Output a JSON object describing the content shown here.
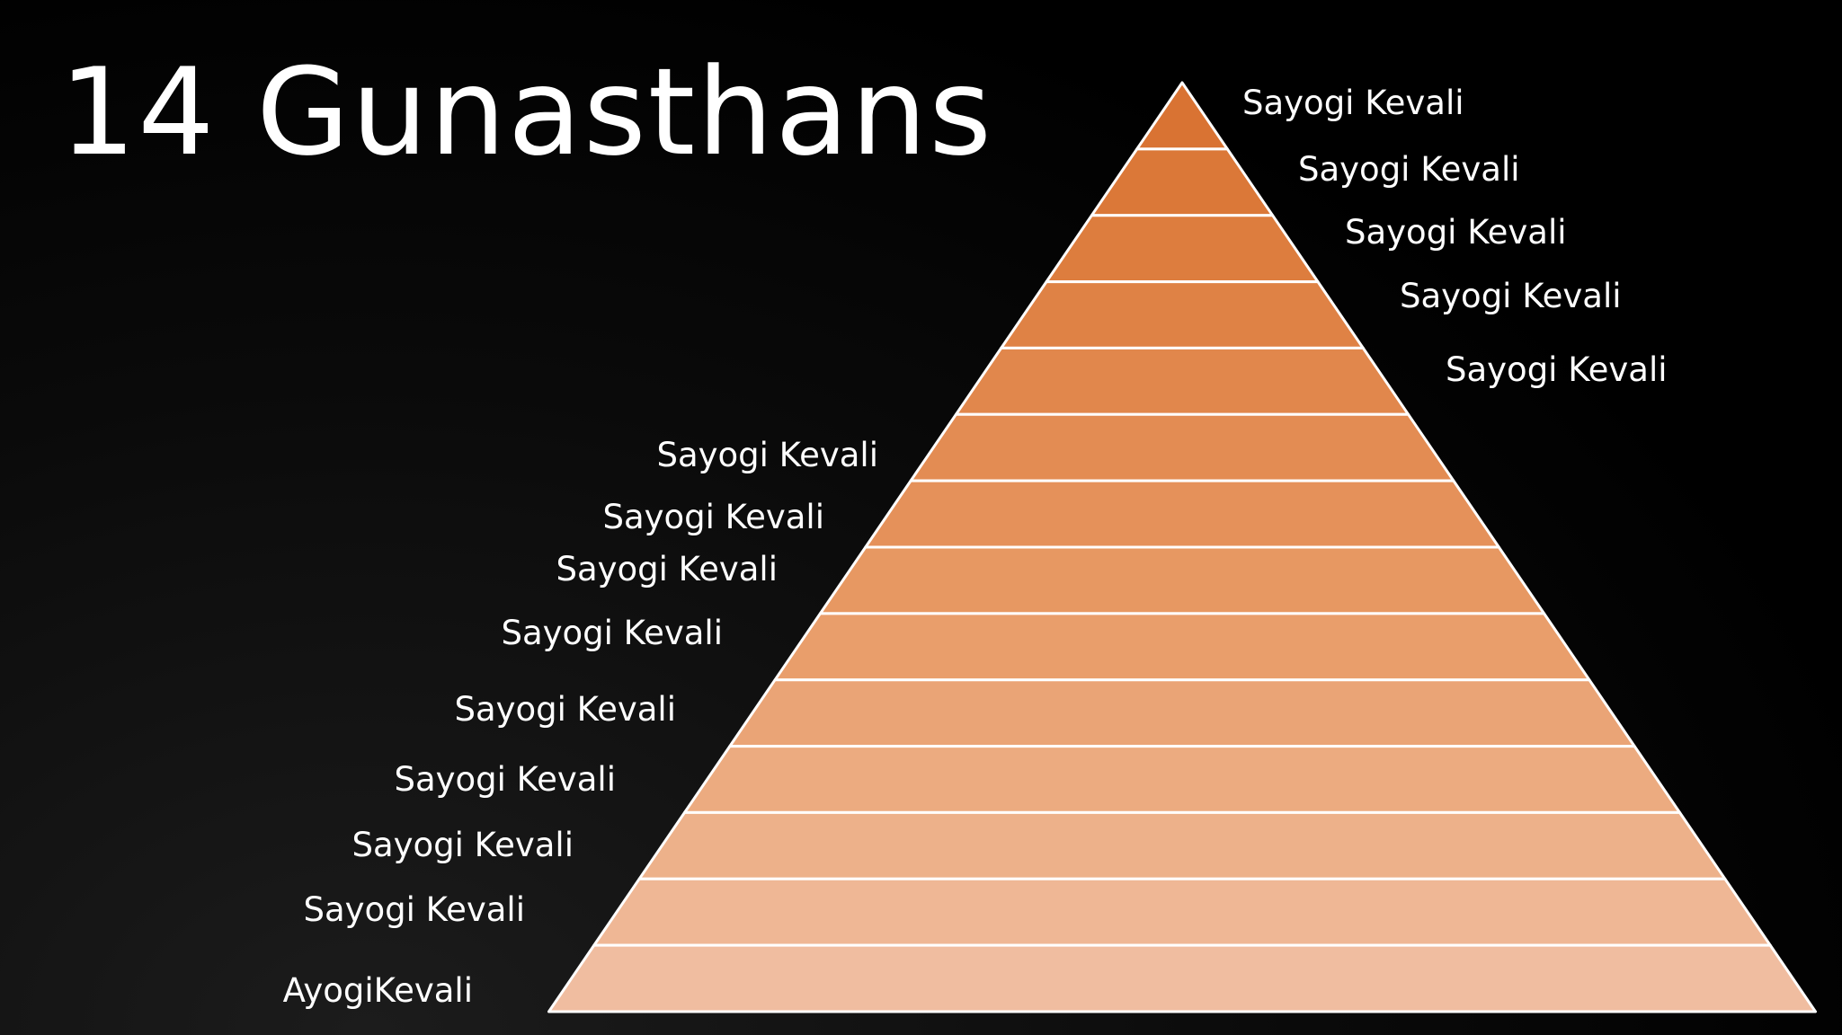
{
  "title": "14 Gunasthans",
  "pyramid": {
    "level_count": 14,
    "fill_colors": [
      "#d97333",
      "#db7838",
      "#dd7d3e",
      "#df8245",
      "#e1874c",
      "#e38c53",
      "#e5915a",
      "#e79862",
      "#e99e6b",
      "#eaa476",
      "#ecab80",
      "#edb18a",
      "#efb795",
      "#f0bda0"
    ],
    "stroke_color": "#ffffff"
  },
  "labels": [
    {
      "text": "Sayogi Kevali"
    },
    {
      "text": "Sayogi Kevali"
    },
    {
      "text": "Sayogi Kevali"
    },
    {
      "text": "Sayogi Kevali"
    },
    {
      "text": "Sayogi Kevali"
    },
    {
      "text": "Sayogi Kevali"
    },
    {
      "text": "Sayogi Kevali"
    },
    {
      "text": "Sayogi Kevali"
    },
    {
      "text": "Sayogi Kevali"
    },
    {
      "text": "Sayogi Kevali"
    },
    {
      "text": "Sayogi Kevali"
    },
    {
      "text": "Sayogi Kevali"
    },
    {
      "text": "Sayogi Kevali"
    },
    {
      "text": "AyogiKevali"
    }
  ]
}
